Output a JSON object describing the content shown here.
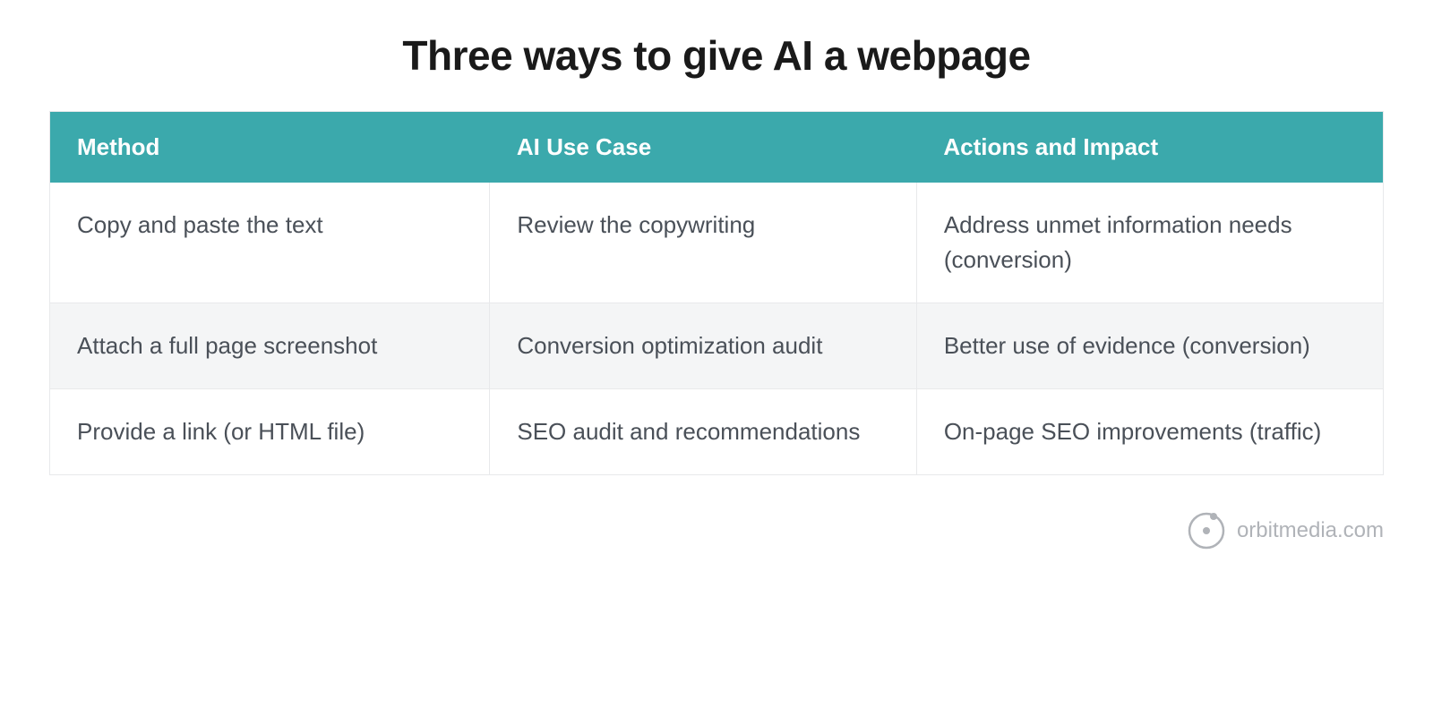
{
  "title": "Three ways to give AI a webpage",
  "table": {
    "headers": [
      "Method",
      "AI Use Case",
      "Actions and Impact"
    ],
    "rows": [
      [
        "Copy and paste the text",
        "Review the copywriting",
        "Address unmet information needs (conversion)"
      ],
      [
        "Attach a full page screenshot",
        "Conversion optimization audit",
        "Better use of evidence (conversion)"
      ],
      [
        "Provide a link (or HTML file)",
        "SEO audit and recommendations",
        "On-page SEO improvements (traffic)"
      ]
    ]
  },
  "footer": {
    "brand": "orbitmedia.com"
  }
}
